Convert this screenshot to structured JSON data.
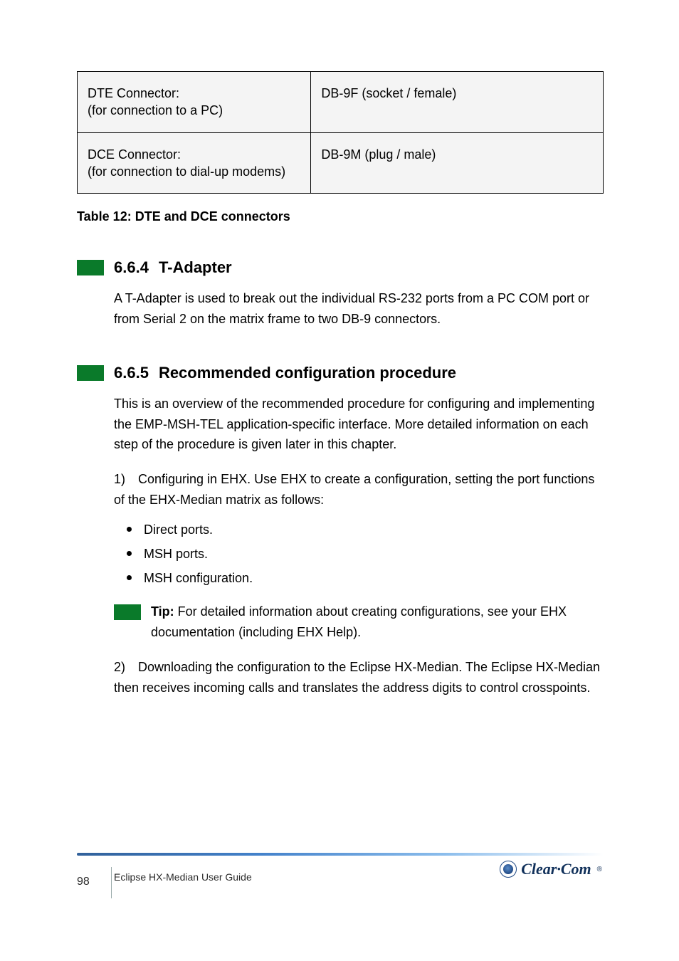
{
  "table": {
    "row1": {
      "left_l1": "DTE Connector:",
      "left_l2": "(for connection to a PC)",
      "right": "DB-9F (socket / female)"
    },
    "row2": {
      "left_l1": "DCE Connector:",
      "left_l2": "(for connection to dial-up modems)",
      "right": "DB-9M (plug / male)"
    },
    "caption": "Table 12: DTE and DCE connectors"
  },
  "sec1": {
    "num": "6.6.4",
    "title": "T-Adapter",
    "text": "A T-Adapter is used to break out the individual RS-232 ports from a PC COM port or from Serial 2 on the matrix frame to two DB-9 connectors."
  },
  "sec2": {
    "num": "6.6.5",
    "title": "Recommended configuration procedure",
    "intro": "This is an overview of the recommended procedure for configuring and implementing the EMP-MSH-TEL application-specific interface. More detailed information on each step of the procedure is given later in this chapter.",
    "step1_n": "1)",
    "step1_t": "Configuring in EHX. Use EHX to create a configuration, setting the port functions of the EHX-Median matrix as follows:",
    "b1": "Direct ports.",
    "b2": "MSH ports.",
    "b3": "MSH configuration.",
    "tip_lead": "Tip:",
    "tip_text": " For detailed information about creating configurations, see your EHX documentation (including EHX Help).",
    "step2_n": "2)",
    "step2_t": "Downloading the configuration to the Eclipse HX-Median. The Eclipse HX-Median then receives incoming calls and translates the address digits to control crosspoints."
  },
  "footer": {
    "page": "98",
    "doc_l1": "Eclipse HX-Median User Guide",
    "brand": "Clear·Com"
  }
}
